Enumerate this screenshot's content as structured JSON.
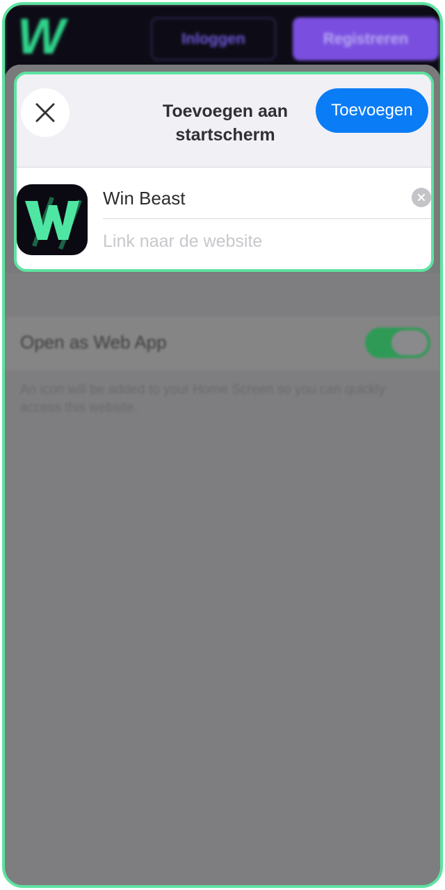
{
  "site": {
    "logo_text": "W",
    "login_label": "Inloggen",
    "register_label": "Registreren"
  },
  "dialog": {
    "title_line1": "Toevoegen aan",
    "title_line2": "startscherm",
    "add_label": "Toevoegen",
    "close_icon": "close-icon",
    "app_icon": "win-beast-app-icon",
    "name_value": "Win Beast",
    "url_placeholder": "Link naar de website"
  },
  "settings": {
    "webapp_label": "Open as Web App",
    "webapp_enabled": true,
    "webapp_description": "An icon will be added to your Home Screen so you can quickly access this website."
  },
  "colors": {
    "accent_highlight": "#5ee3a0",
    "primary_button": "#0a7cf5",
    "brand_green": "#2ed38a",
    "toggle_on": "#2f9a55"
  }
}
